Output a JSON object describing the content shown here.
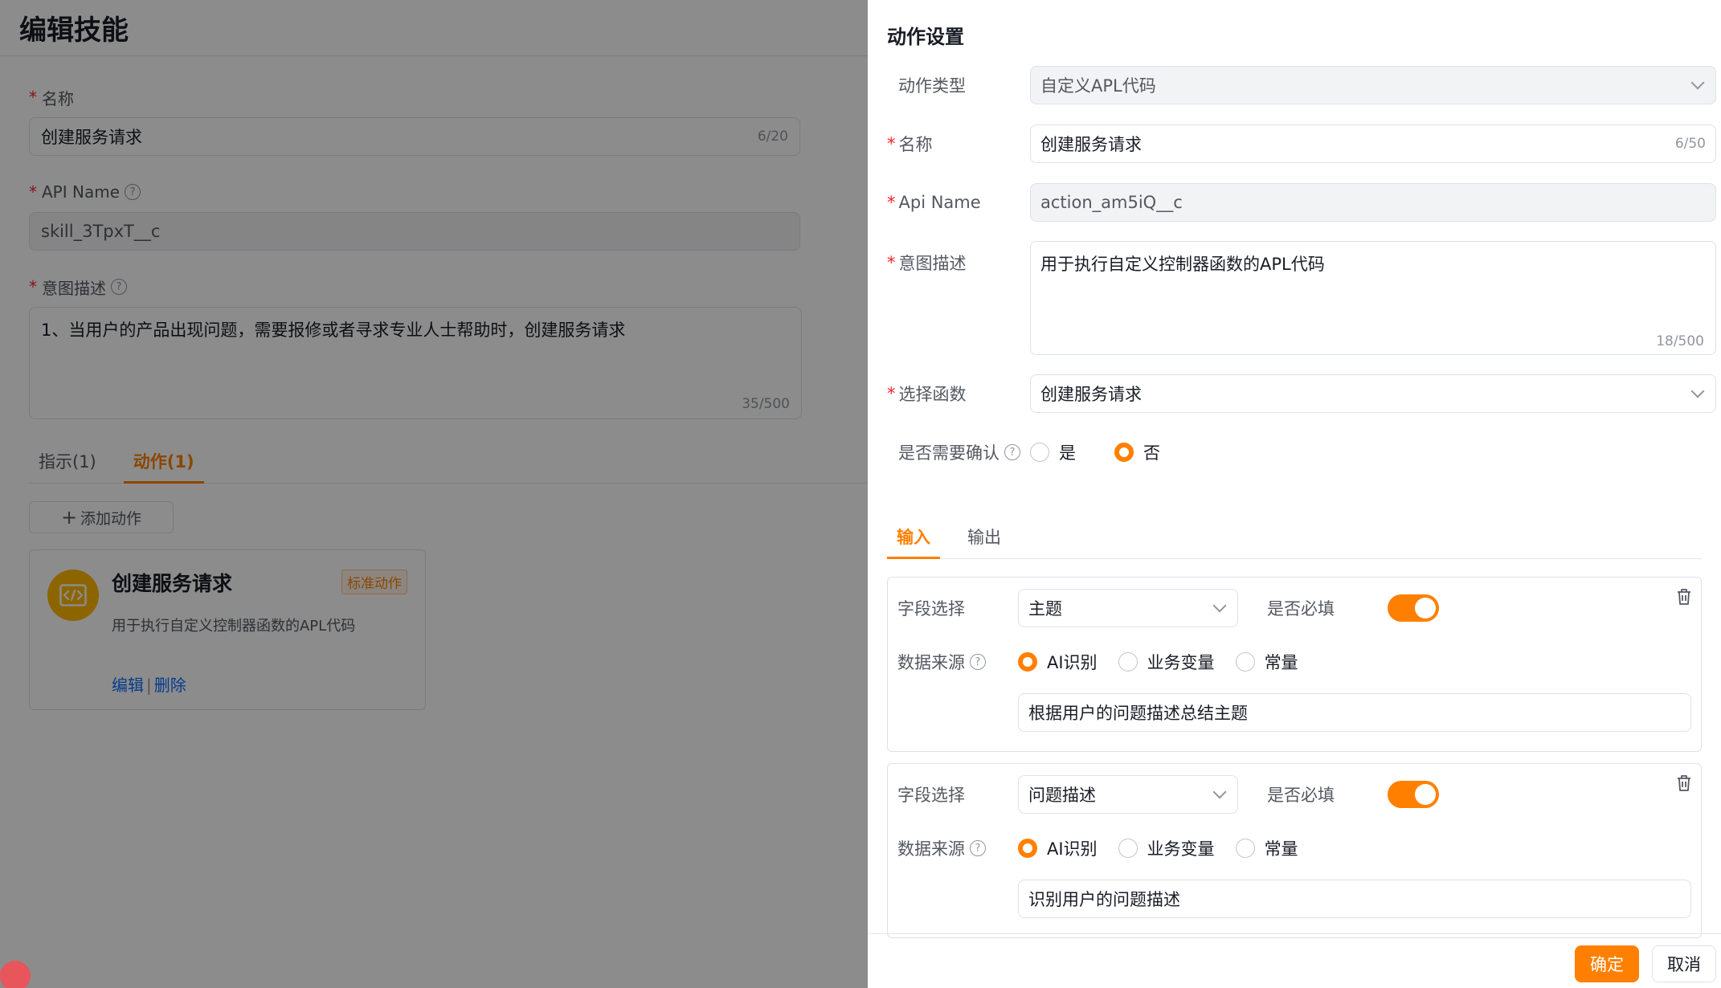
{
  "page": {
    "title": "编辑技能",
    "name_label": "名称",
    "name_value": "创建服务请求",
    "name_counter": "6/20",
    "api_label": "API Name",
    "api_value": "skill_3TpxT__c",
    "intent_label": "意图描述",
    "intent_value": "1、当用户的产品出现问题，需要报修或者寻求专业人士帮助时，创建服务请求",
    "intent_counter": "35/500",
    "tabs": [
      {
        "label": "指示(1)"
      },
      {
        "label": "动作(1)"
      }
    ],
    "add_action_label": "添加动作",
    "card": {
      "title": "创建服务请求",
      "tag": "标准动作",
      "desc": "用于执行自定义控制器函数的APL代码",
      "edit": "编辑",
      "sep": "|",
      "delete": "删除"
    }
  },
  "drawer": {
    "title": "动作设置",
    "action_type_label": "动作类型",
    "action_type_value": "自定义APL代码",
    "name_label": "名称",
    "name_value": "创建服务请求",
    "name_counter": "6/50",
    "api_label": "Api Name",
    "api_value": "action_am5iQ__c",
    "intent_label": "意图描述",
    "intent_value": "用于执行自定义控制器函数的APL代码",
    "intent_counter": "18/500",
    "func_label": "选择函数",
    "func_value": "创建服务请求",
    "confirm_label": "是否需要确认",
    "confirm_yes": "是",
    "confirm_no": "否",
    "tabs": [
      {
        "label": "输入"
      },
      {
        "label": "输出"
      }
    ],
    "fields": [
      {
        "field_label": "字段选择",
        "field_value": "主题",
        "required_label": "是否必填",
        "source_label": "数据来源",
        "sources": [
          "AI识别",
          "业务变量",
          "常量"
        ],
        "desc_value": "根据用户的问题描述总结主题"
      },
      {
        "field_label": "字段选择",
        "field_value": "问题描述",
        "required_label": "是否必填",
        "source_label": "数据来源",
        "sources": [
          "AI识别",
          "业务变量",
          "常量"
        ],
        "desc_value": "识别用户的问题描述"
      }
    ],
    "ok_label": "确定",
    "cancel_label": "取消"
  },
  "colors": {
    "accent": "#ff8000",
    "link": "#0c6cff",
    "required": "#f5222d",
    "icon_bg": "#ffb800"
  }
}
